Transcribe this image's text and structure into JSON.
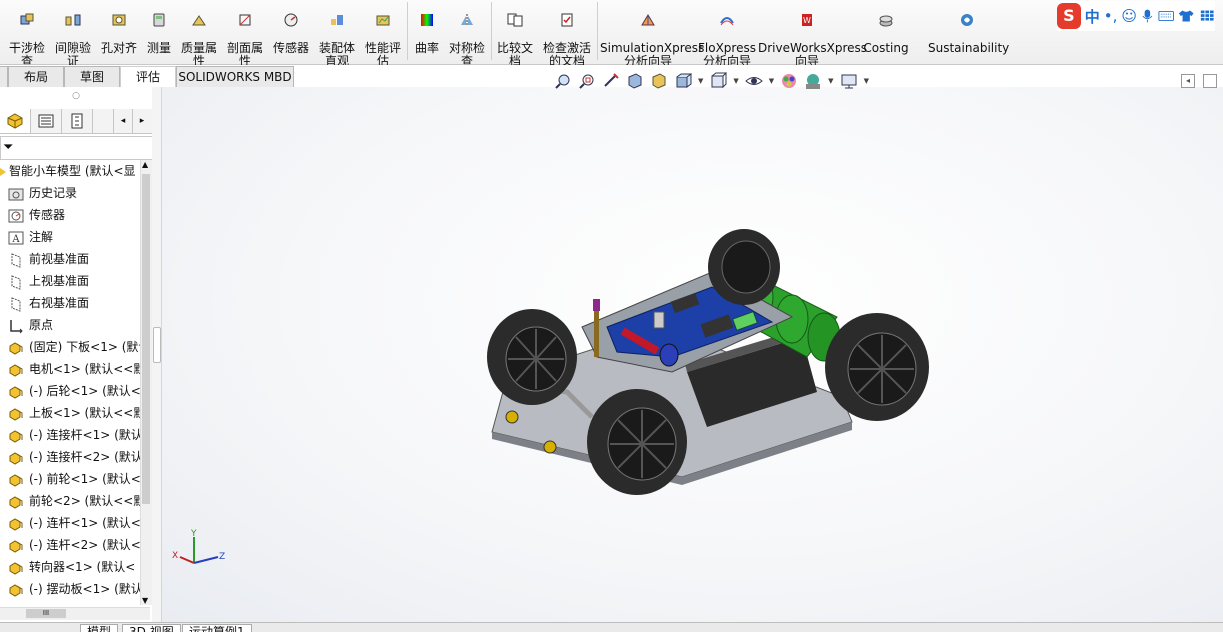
{
  "ribbon": {
    "buttons": [
      {
        "label": "干涉检\n查",
        "icon": "interference-check-icon"
      },
      {
        "label": "间隙验\n证",
        "icon": "clearance-icon"
      },
      {
        "label": "孔对齐",
        "icon": "hole-align-icon"
      },
      {
        "label": "测量",
        "icon": "measure-icon"
      },
      {
        "label": "质量属\n性",
        "icon": "mass-properties-icon"
      },
      {
        "label": "剖面属\n性",
        "icon": "section-properties-icon"
      },
      {
        "label": "传感器",
        "icon": "sensor-icon"
      },
      {
        "label": "装配体\n直观",
        "icon": "assembly-visualization-icon"
      },
      {
        "label": "性能评\n估",
        "icon": "performance-icon"
      },
      {
        "label": "曲率",
        "icon": "curvature-icon"
      },
      {
        "label": "对称检\n查",
        "icon": "symmetry-icon"
      },
      {
        "label": "比较文\n档",
        "icon": "compare-icon"
      },
      {
        "label": "检查激活\n的文档",
        "icon": "check-active-icon"
      },
      {
        "label": "SimulationXpress\n分析向导",
        "icon": "simulation-icon"
      },
      {
        "label": "FloXpress\n分析向导",
        "icon": "floxpress-icon"
      },
      {
        "label": "DriveWorksXpress\n向导",
        "icon": "driveworks-icon"
      },
      {
        "label": "Costing",
        "icon": "costing-icon"
      },
      {
        "label": "Sustainability",
        "icon": "sustainability-icon"
      }
    ]
  },
  "ime": {
    "logo": "S",
    "lang": "中",
    "punct": "•,"
  },
  "tabs": [
    {
      "label": "布局"
    },
    {
      "label": "草图"
    },
    {
      "label": "评估"
    },
    {
      "label": "SOLIDWORKS MBD"
    }
  ],
  "tree": {
    "root": "智能小车模型  (默认<显",
    "items": [
      {
        "label": "历史记录",
        "icon": "history-icon"
      },
      {
        "label": "传感器",
        "icon": "sensor-icon"
      },
      {
        "label": "注解",
        "icon": "annotation-icon"
      },
      {
        "label": "前视基准面",
        "icon": "plane-icon"
      },
      {
        "label": "上视基准面",
        "icon": "plane-icon"
      },
      {
        "label": "右视基准面",
        "icon": "plane-icon"
      },
      {
        "label": "原点",
        "icon": "origin-icon"
      },
      {
        "label": "(固定) 下板<1> (默认",
        "icon": "part-icon"
      },
      {
        "label": "电机<1> (默认<<默",
        "icon": "part-icon"
      },
      {
        "label": "(-) 后轮<1> (默认<",
        "icon": "part-icon"
      },
      {
        "label": "上板<1> (默认<<默",
        "icon": "part-icon"
      },
      {
        "label": "(-) 连接杆<1> (默认",
        "icon": "part-icon"
      },
      {
        "label": "(-) 连接杆<2> (默认",
        "icon": "part-icon"
      },
      {
        "label": "(-) 前轮<1> (默认<",
        "icon": "part-icon"
      },
      {
        "label": "前轮<2> (默认<<默",
        "icon": "part-icon"
      },
      {
        "label": "(-) 连杆<1> (默认<",
        "icon": "part-icon"
      },
      {
        "label": "(-) 连杆<2> (默认<",
        "icon": "part-icon"
      },
      {
        "label": "转向器<1> (默认<",
        "icon": "part-icon"
      },
      {
        "label": "(-) 摆动板<1> (默认",
        "icon": "part-icon"
      }
    ]
  },
  "bottom_tabs": [
    {
      "label": "模型"
    },
    {
      "label": "3D 视图"
    },
    {
      "label": "运动算例1"
    }
  ],
  "triad": {
    "x": "X",
    "y": "Y",
    "z": "Z"
  },
  "colors": {
    "pcb": "#1d3fa8",
    "motor": "#2ca02c",
    "tire": "#2b2b2b",
    "plate": "#a9aeb5"
  }
}
